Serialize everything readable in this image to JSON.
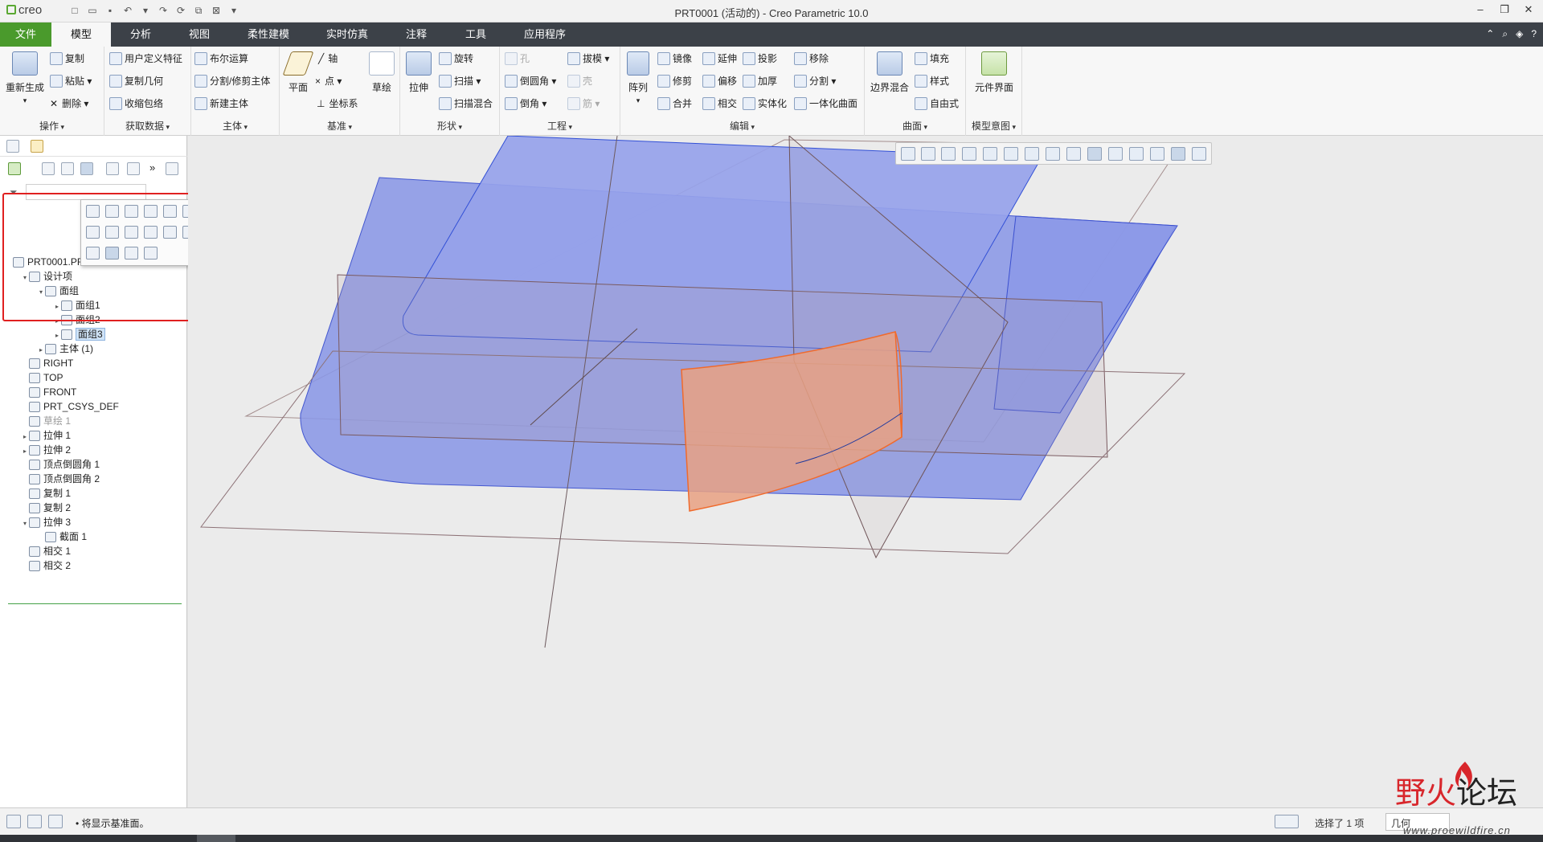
{
  "app": {
    "logo": "creo",
    "window_title": "PRT0001 (活动的) - Creo Parametric 10.0"
  },
  "ribbon_tabs": [
    "文件",
    "模型",
    "分析",
    "视图",
    "柔性建模",
    "实时仿真",
    "注释",
    "工具",
    "应用程序"
  ],
  "active_tab": "模型",
  "ribbon": {
    "ops": {
      "label": "操作",
      "regen": "重新生成",
      "copy": "复制",
      "paste": "粘贴",
      "delete": "删除"
    },
    "getdata": {
      "label": "获取数据",
      "udf": "用户定义特征",
      "copygeom": "复制几何",
      "shrinkwrap": "收缩包络"
    },
    "body": {
      "label": "主体",
      "boolean": "布尔运算",
      "split": "分割/修剪主体",
      "newbody": "新建主体"
    },
    "datum": {
      "label": "基准",
      "plane": "平面",
      "axis": "轴",
      "point": "点",
      "csys": "坐标系",
      "sketch": "草绘"
    },
    "shapes": {
      "label": "形状",
      "extrude": "拉伸",
      "revolve": "旋转",
      "sweep": "扫描",
      "sweptblend": "扫描混合"
    },
    "eng": {
      "label": "工程",
      "hole": "孔",
      "round": "倒圆角",
      "chamfer": "倒角",
      "draft": "拔模",
      "shell": "壳",
      "rib": "筋"
    },
    "edit": {
      "label": "编辑",
      "pattern": "阵列",
      "mirror": "镜像",
      "trim": "修剪",
      "merge": "合并",
      "extend": "延伸",
      "offset": "偏移",
      "intersect": "相交",
      "project": "投影",
      "thicken": "加厚",
      "solidify": "实体化",
      "remove": "移除",
      "split": "分割",
      "unify": "一体化曲面"
    },
    "surfaces": {
      "label": "曲面",
      "boundary": "边界混合",
      "fill": "填充",
      "style": "样式",
      "freestyle": "自由式"
    },
    "intent": {
      "label": "模型意图",
      "interface": "元件界面"
    }
  },
  "tree": [
    {
      "label": "PRT0001.PR",
      "indent": 0,
      "twist": ""
    },
    {
      "label": "设计项",
      "indent": 1,
      "twist": "▾"
    },
    {
      "label": "面组",
      "indent": 2,
      "twist": "▾"
    },
    {
      "label": "面组1",
      "indent": 3,
      "twist": "▸"
    },
    {
      "label": "面组2",
      "indent": 3,
      "twist": "▸"
    },
    {
      "label": "面组3",
      "indent": 3,
      "twist": "▸",
      "selected": true
    },
    {
      "label": "主体 (1)",
      "indent": 2,
      "twist": "▸"
    },
    {
      "label": "RIGHT",
      "indent": 1,
      "twist": ""
    },
    {
      "label": "TOP",
      "indent": 1,
      "twist": ""
    },
    {
      "label": "FRONT",
      "indent": 1,
      "twist": ""
    },
    {
      "label": "PRT_CSYS_DEF",
      "indent": 1,
      "twist": ""
    },
    {
      "label": "草绘 1",
      "indent": 1,
      "twist": "",
      "dim": true
    },
    {
      "label": "拉伸 1",
      "indent": 1,
      "twist": "▸"
    },
    {
      "label": "拉伸 2",
      "indent": 1,
      "twist": "▸"
    },
    {
      "label": "顶点倒圆角 1",
      "indent": 1,
      "twist": ""
    },
    {
      "label": "顶点倒圆角 2",
      "indent": 1,
      "twist": ""
    },
    {
      "label": "复制 1",
      "indent": 1,
      "twist": ""
    },
    {
      "label": "复制 2",
      "indent": 1,
      "twist": ""
    },
    {
      "label": "拉伸 3",
      "indent": 1,
      "twist": "▾"
    },
    {
      "label": "截面 1",
      "indent": 2,
      "twist": ""
    },
    {
      "label": "相交 1",
      "indent": 1,
      "twist": ""
    },
    {
      "label": "相交 2",
      "indent": 1,
      "twist": ""
    }
  ],
  "status": {
    "message": "• 将显示基准面。",
    "selection": "选择了 1 项",
    "filter": "几何"
  },
  "watermark": {
    "text_a": "野",
    "text_b": "火",
    "text_c": "论坛",
    "url": "www.proewildfire.cn"
  },
  "colors": {
    "accent_green": "#4a9a2c",
    "tabbar": "#3c4148",
    "surface_blue": "#8a97e6",
    "surface_orange": "#e9a183",
    "highlight_red": "#e02020"
  }
}
